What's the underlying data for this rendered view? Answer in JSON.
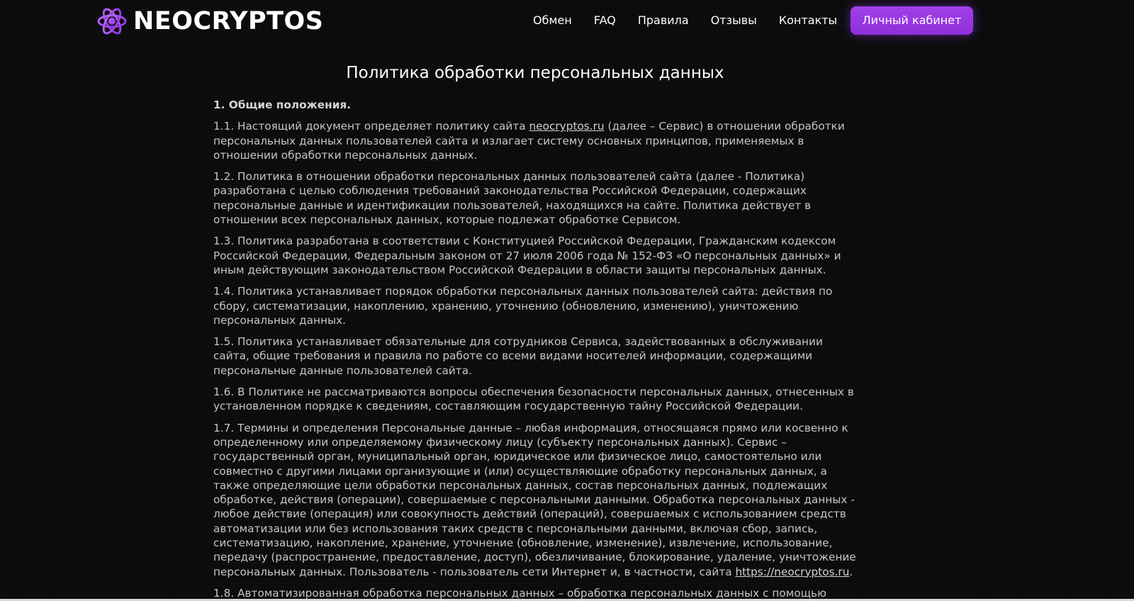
{
  "brand": {
    "name": "NEOCRYPTOS",
    "accent_color": "#9b3be6",
    "icon": "atom-icon"
  },
  "nav": {
    "items": [
      {
        "label": "Обмен"
      },
      {
        "label": "FAQ"
      },
      {
        "label": "Правила"
      },
      {
        "label": "Отзывы"
      },
      {
        "label": "Контакты"
      }
    ],
    "cabinet_label": "Личный кабинет"
  },
  "page": {
    "title": "Политика обработки персональных данных"
  },
  "policy": {
    "section1_heading": "1. Общие положения.",
    "p1_1_before": "1.1. Настоящий документ определяет политику сайта ",
    "p1_1_link": "neocryptos.ru",
    "p1_1_after": " (далее – Сервис) в отношении обработки персональных данных пользователей сайта и излагает систему основных принципов, применяемых в отношении обработки персональных данных.",
    "p1_2": "1.2. Политика в отношении обработки персональных данных пользователей сайта (далее - Политика) разработана с целью соблюдения требований законодательства Российской Федерации, содержащих персональные данные и идентификации пользователей, находящихся на сайте. Политика действует в отношении всех персональных данных, которые подлежат обработке Сервисом.",
    "p1_3": "1.3. Политика разработана в соответствии с Конституцией Российской Федерации, Гражданским кодексом Российской Федерации, Федеральным законом от 27 июля 2006 года № 152-ФЗ «О персональных данных» и иным действующим законодательством Российской Федерации в области защиты персональных данных.",
    "p1_4": "1.4. Политика устанавливает порядок обработки персональных данных пользователей сайта: действия по сбору, систематизации, накоплению, хранению, уточнению (обновлению, изменению), уничтожению персональных данных.",
    "p1_5": "1.5. Политика устанавливает обязательные для сотрудников Сервиса, задействованных в обслуживании сайта, общие требования и правила по работе со всеми видами носителей информации, содержащими персональные данные пользователей сайта.",
    "p1_6": "1.6. В Политике не рассматриваются вопросы обеспечения безопасности персональных данных, отнесенных в установленном порядке к сведениям, составляющим государственную тайну Российской Федерации.",
    "p1_7_before": "1.7. Термины и определения Персональные данные – любая информация, относящаяся прямо или косвенно к определенному или определяемому физическому лицу (субъекту персональных данных). Сервис – государственный орган, муниципальный орган, юридическое или физическое лицо, самостоятельно или совместно с другими лицами организующие и (или) осуществляющие обработку персональных данных, а также определяющие цели обработки персональных данных, состав персональных данных, подлежащих обработке, действия (операции), совершаемые с персональными данными. Обработка персональных данных - любое действие (операция) или совокупность действий (операций), совершаемых с использованием средств автоматизации или без использования таких средств с персональными данными, включая сбор, запись, систематизацию, накопление, хранение, уточнение (обновление, изменение), извлечение, использование, передачу (распространение, предоставление, доступ), обезличивание, блокирование, удаление, уничтожение персональных данных. Пользователь - пользователь сети Интернет и, в частности, сайта ",
    "p1_7_link": "https://neocryptos.ru",
    "p1_7_after": ".",
    "p1_8": "1.8. Автоматизированная обработка персональных данных – обработка персональных данных с помощью"
  }
}
